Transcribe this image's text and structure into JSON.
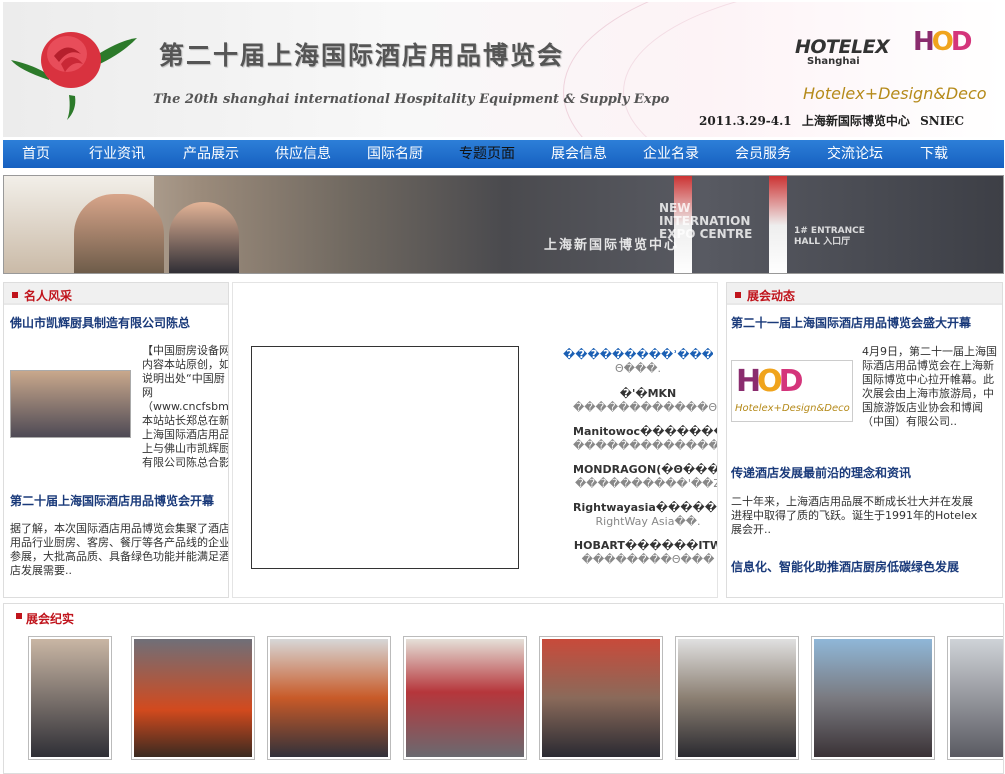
{
  "header": {
    "title_cn": "第二十届上海国际酒店用品博览会",
    "title_en": "The 20th shanghai international Hospitality Equipment & Supply Expo",
    "logo_hotelex": "HOTELEX",
    "logo_hotelex_city": "Shanghai",
    "logo_hod_h": "H",
    "logo_hod_o": "O",
    "logo_hod_d": "D",
    "tagline": "Hotelex+Design&Deco",
    "date": "2011.3.29-4.1",
    "venue": "上海新国际博览中心",
    "venue_abbr": "SNIEC"
  },
  "nav": {
    "items": [
      {
        "label": "首页"
      },
      {
        "label": "行业资讯"
      },
      {
        "label": "产品展示"
      },
      {
        "label": "供应信息"
      },
      {
        "label": "国际名厨"
      },
      {
        "label": "专题页面"
      },
      {
        "label": "展会信息"
      },
      {
        "label": "企业名录"
      },
      {
        "label": "会员服务"
      },
      {
        "label": "交流论坛"
      },
      {
        "label": "下载"
      }
    ],
    "active_index": 5
  },
  "banner": {
    "sign_en": "NEW INTERNATION EXPO CENTRE",
    "sign_cn": "上海新国际博览中心",
    "entrance": "1# ENTRANCE HALL 入口厅"
  },
  "celebrity": {
    "heading": "名人风采",
    "article1_title": "佛山市凯辉厨具制造有限公司陈总",
    "article1_body": "【中国厨房设备网内容本站原创，如说明出处“中国厨网（www.cncfsbmh.本站站长郑总在新上海国际酒店用品上与佛山市凯辉厨有限公司陈总合影",
    "article2_title": "第二十届上海国际酒店用品博览会开幕",
    "article2_body": "据了解，本次国际酒店用品博览会集聚了酒店用品行业厨房、客房、餐厅等各产品线的企业参展，大批高品质、具备绿色功能并能满足酒店发展需要.."
  },
  "brands": [
    {
      "name": "���������ʾ���",
      "sub": "Θ���."
    },
    {
      "name": "�'�MKN",
      "sub": "������������Θ���"
    },
    {
      "name": "Manitowoc����������",
      "sub": "�������������ʾ"
    },
    {
      "name": "MONDRAGON(�Θ����",
      "sub": "����������'��Z"
    },
    {
      "name": "Rightwayasia�������",
      "sub": "RightWay Asia��."
    },
    {
      "name": "HOBART������ITW",
      "sub": "��������Θ���"
    }
  ],
  "news": {
    "heading": "展会动态",
    "article1_title": "第二十一届上海国际酒店用品博览会盛大开幕",
    "article1_body": "4月9日，第二十一届上海国际酒店用品博览会在上海新国际博览中心拉开帷幕。此次展会由上海市旅游局，中国旅游饭店业协会和博闻（中国）有限公司..",
    "article2_title": "传递酒店发展最前沿的理念和资讯",
    "article2_body": "二十年来，上海酒店用品展不断成长壮大并在发展进程中取得了质的飞跃。诞生于1991年的Hotelex展会开..",
    "article3_title": "信息化、智能化助推酒店厨房低碳绿色发展"
  },
  "gallery": {
    "heading": "展会纪实",
    "count": 8
  }
}
